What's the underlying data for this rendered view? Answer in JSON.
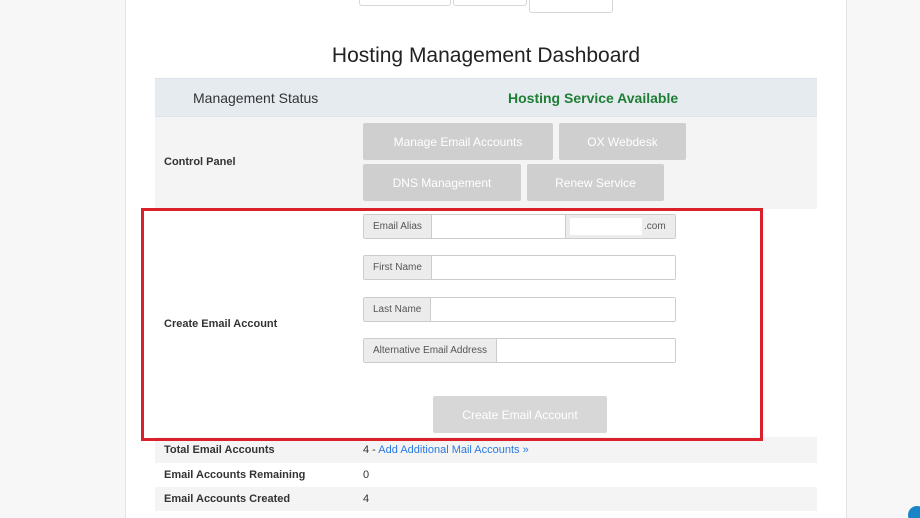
{
  "page_title": "Hosting Management Dashboard",
  "management_status": {
    "label": "Management Status",
    "value": "Hosting Service Available"
  },
  "control_panel": {
    "label": "Control Panel",
    "buttons": {
      "manage_email": "Manage Email Accounts",
      "ox_webdesk": "OX Webdesk",
      "dns_management": "DNS Management",
      "renew_service": "Renew Service"
    }
  },
  "create_email": {
    "label": "Create Email Account",
    "email_alias_label": "Email Alias",
    "email_alias_value": "",
    "domain_suffix": ".com",
    "first_name_label": "First Name",
    "first_name_value": "",
    "last_name_label": "Last Name",
    "last_name_value": "",
    "alt_email_label": "Alternative Email Address",
    "alt_email_value": "",
    "submit_label": "Create Email Account"
  },
  "stats": {
    "total_label": "Total Email Accounts",
    "total_value": "4",
    "total_sep": " - ",
    "add_link": "Add Additional Mail Accounts »",
    "remaining_label": "Email Accounts Remaining",
    "remaining_value": "0",
    "created_label": "Email Accounts Created",
    "created_value": "4"
  },
  "colors": {
    "status_available": "#1e7e34",
    "link": "#2a7ae2",
    "highlight": "#d9202b",
    "button_disabled": "#cfcfcf"
  }
}
